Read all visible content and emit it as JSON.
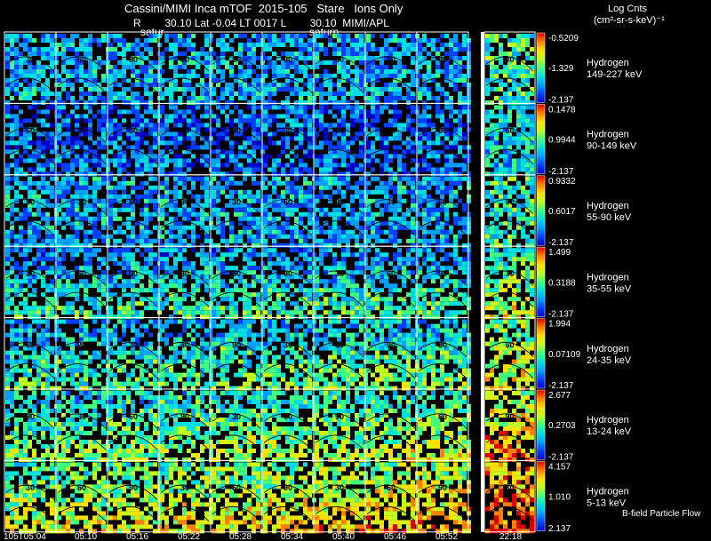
{
  "header": {
    "title": "Cassini/MIMI Inca mTOF  2015-105   Stare   Ions Only",
    "subtitle": "R        30.10 Lat -0.04 LT 0017 L        30.10  MIMI/APL",
    "saturn_label_1": "satur",
    "saturn_label_2": "saturn",
    "units_line1": "Log Cnts",
    "units_line2": "(cm²-sr-s-keV)⁻¹",
    "flow_label": "B-field Particle Flow"
  },
  "colors": {
    "background": "#000000",
    "grid": "#ffffff",
    "colormap": [
      "#0000c8",
      "#0040ff",
      "#00a0ff",
      "#00e0e0",
      "#40ff80",
      "#c0ff20",
      "#ffe000",
      "#ff8000",
      "#e00000"
    ]
  },
  "chart_data": {
    "type": "heatmap",
    "time_labels": [
      "105T05:04",
      "05:10",
      "05:16",
      "05:22",
      "05:28",
      "05:34",
      "05:40",
      "05:46",
      "05:52",
      "22:18"
    ],
    "contour_labels": [
      "30",
      "60",
      "90"
    ],
    "rows": [
      {
        "species": "Hydrogen",
        "energy": "149-227 keV",
        "cb_max": "-0.5209",
        "cb_mid": "-1.329",
        "cb_min": "-2.137",
        "level": 0.3
      },
      {
        "species": "Hydrogen",
        "energy": "90-149 keV",
        "cb_max": "0.1478",
        "cb_mid": "0.9944",
        "cb_min": "-2.137",
        "level": 0.22
      },
      {
        "species": "Hydrogen",
        "energy": "55-90 keV",
        "cb_max": "0.9332",
        "cb_mid": "0.6017",
        "cb_min": "-2.137",
        "level": 0.3
      },
      {
        "species": "Hydrogen",
        "energy": "35-55 keV",
        "cb_max": "1.499",
        "cb_mid": "0.3188",
        "cb_min": "-2.137",
        "level": 0.35
      },
      {
        "species": "Hydrogen",
        "energy": "24-35 keV",
        "cb_max": "1.994",
        "cb_mid": "0.07109",
        "cb_min": "-2.137",
        "level": 0.38
      },
      {
        "species": "Hydrogen",
        "energy": "13-24 keV",
        "cb_max": "2.677",
        "cb_mid": "0.2703",
        "cb_min": "-2.137",
        "level": 0.45
      },
      {
        "species": "Hydrogen",
        "energy": "5-13 keV",
        "cb_max": "4.157",
        "cb_mid": "1.010",
        "cb_min": "2.137",
        "level": 0.55
      }
    ]
  }
}
